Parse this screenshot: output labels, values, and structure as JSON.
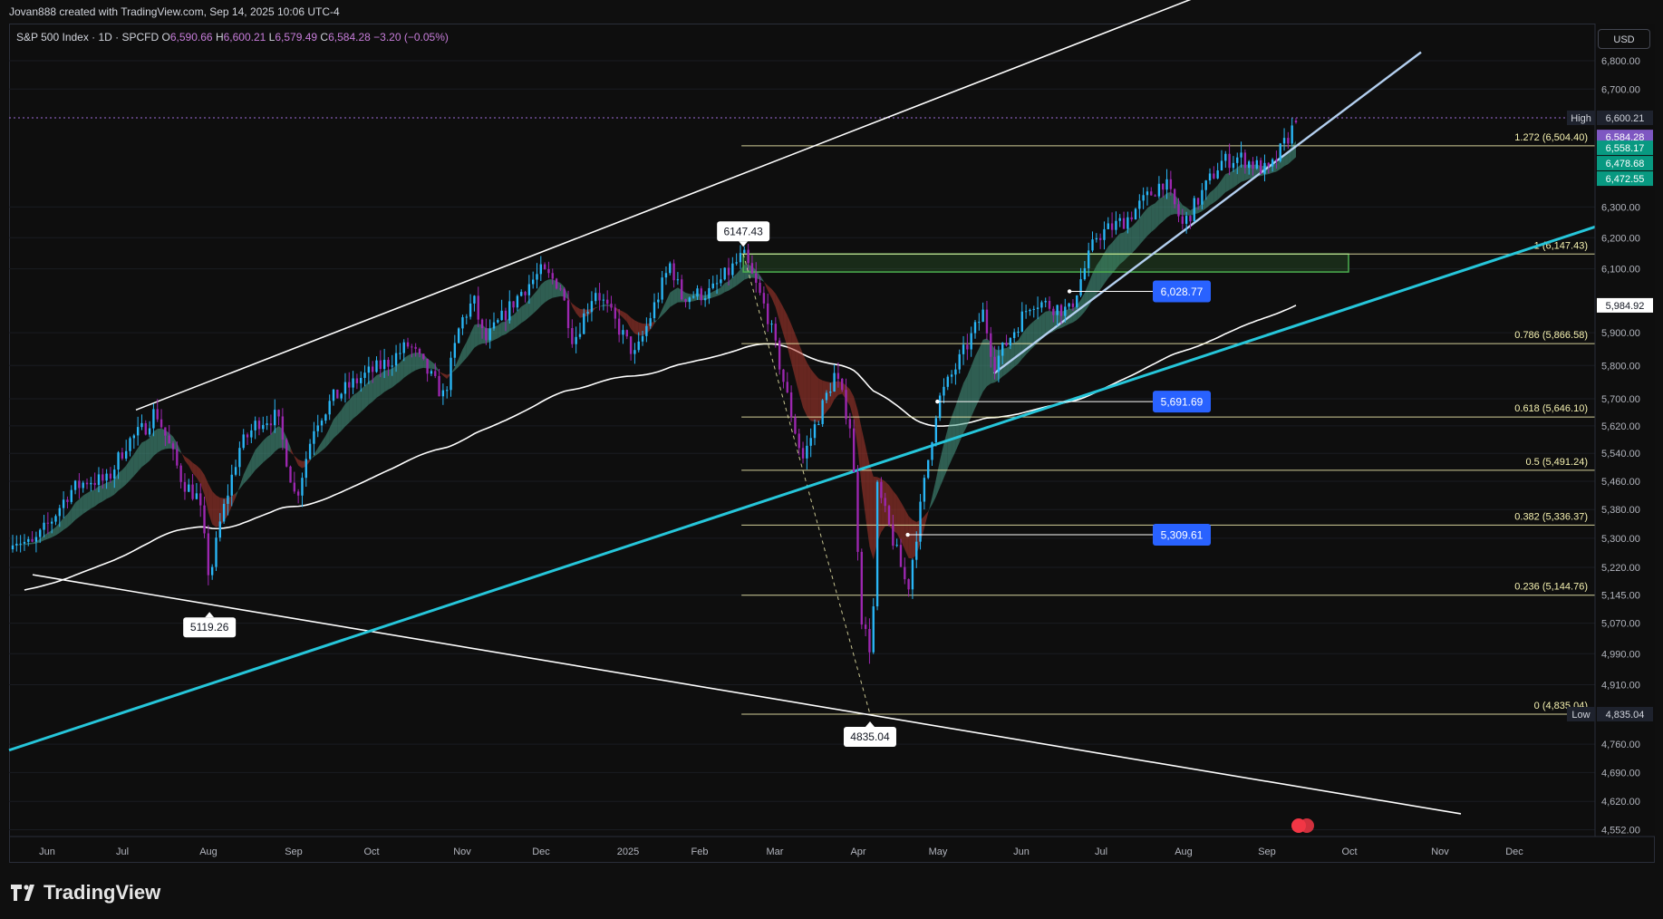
{
  "header": {
    "attribution": "Jovan888 created with TradingView.com, Sep 14, 2025 10:06 UTC-4"
  },
  "legend": {
    "symbol": "S&P 500 Index · 1D · SPCFD",
    "open_label": "O",
    "open": "6,590.66",
    "high_label": "H",
    "high": "6,600.21",
    "low_label": "L",
    "low": "6,579.49",
    "close_label": "C",
    "close": "6,584.28",
    "change": "−3.20 (−0.05%)"
  },
  "currency_button": "USD",
  "footer": {
    "brand": "TradingView"
  },
  "colors": {
    "background": "#0e0e0e",
    "up_candle": "#29b6f6",
    "down_candle": "#9c27b0",
    "ribbon_up": "#4aa08a",
    "ribbon_down": "#b03a30",
    "channel_line": "#ffffff",
    "cyan_trend": "#26c6da",
    "light_trend": "#b3cfef",
    "fib_line": "#f5f1b0",
    "zone": "#4caf50",
    "price_tag_blue": "#2962ff",
    "high_tag": "#7e57c2",
    "green_tag": "#089981"
  },
  "chart_data": {
    "type": "candlestick",
    "title": "S&P 500 Index · 1D · SPCFD",
    "x_ticks": [
      "Jun",
      "Jul",
      "Aug",
      "Sep",
      "Oct",
      "Nov",
      "Dec",
      "2025",
      "Feb",
      "Mar",
      "Apr",
      "May",
      "Jun",
      "Jul",
      "Aug",
      "Sep",
      "Oct",
      "Nov",
      "Dec"
    ],
    "y_ticks": [
      "6,800.00",
      "6,700.00",
      "6,300.00",
      "6,200.00",
      "6,100.00",
      "5,900.00",
      "5,800.00",
      "5,700.00",
      "5,620.00",
      "5,540.00",
      "5,460.00",
      "5,380.00",
      "5,300.00",
      "5,220.00",
      "5,145.00",
      "5,070.00",
      "4,990.00",
      "4,910.00",
      "4,760.00",
      "4,690.00",
      "4,620.00",
      "4,552.00"
    ],
    "y_range": [
      4552,
      6800
    ],
    "y_scale": "log",
    "price_anchors": [
      {
        "date": "2024-05-24",
        "close": 5304
      },
      {
        "date": "2024-05-31",
        "close": 5278
      },
      {
        "date": "2024-06-07",
        "close": 5346
      },
      {
        "date": "2024-06-14",
        "close": 5431
      },
      {
        "date": "2024-06-21",
        "close": 5464
      },
      {
        "date": "2024-06-28",
        "close": 5460
      },
      {
        "date": "2024-07-05",
        "close": 5567
      },
      {
        "date": "2024-07-12",
        "close": 5615
      },
      {
        "date": "2024-07-16",
        "close": 5667
      },
      {
        "date": "2024-07-26",
        "close": 5459
      },
      {
        "date": "2024-08-01",
        "close": 5410
      },
      {
        "date": "2024-08-05",
        "close": 5186
      },
      {
        "date": "2024-08-09",
        "close": 5344
      },
      {
        "date": "2024-08-16",
        "close": 5554
      },
      {
        "date": "2024-08-23",
        "close": 5634
      },
      {
        "date": "2024-08-30",
        "close": 5648
      },
      {
        "date": "2024-09-06",
        "close": 5408
      },
      {
        "date": "2024-09-13",
        "close": 5626
      },
      {
        "date": "2024-09-20",
        "close": 5702
      },
      {
        "date": "2024-09-30",
        "close": 5762
      },
      {
        "date": "2024-10-11",
        "close": 5815
      },
      {
        "date": "2024-10-18",
        "close": 5864
      },
      {
        "date": "2024-10-31",
        "close": 5705
      },
      {
        "date": "2024-11-06",
        "close": 5929
      },
      {
        "date": "2024-11-11",
        "close": 6001
      },
      {
        "date": "2024-11-15",
        "close": 5870
      },
      {
        "date": "2024-11-29",
        "close": 6032
      },
      {
        "date": "2024-12-06",
        "close": 6090
      },
      {
        "date": "2024-12-13",
        "close": 6051
      },
      {
        "date": "2024-12-18",
        "close": 5872
      },
      {
        "date": "2024-12-26",
        "close": 6037
      },
      {
        "date": "2025-01-10",
        "close": 5827
      },
      {
        "date": "2025-01-23",
        "close": 6118
      },
      {
        "date": "2025-01-27",
        "close": 6012
      },
      {
        "date": "2025-02-07",
        "close": 6026
      },
      {
        "date": "2025-02-19",
        "close": 6144
      },
      {
        "date": "2025-02-28",
        "close": 5955
      },
      {
        "date": "2025-03-10",
        "close": 5614
      },
      {
        "date": "2025-03-13",
        "close": 5522
      },
      {
        "date": "2025-03-25",
        "close": 5776
      },
      {
        "date": "2025-03-31",
        "close": 5612
      },
      {
        "date": "2025-04-04",
        "close": 5074
      },
      {
        "date": "2025-04-08",
        "close": 4982
      },
      {
        "date": "2025-04-09",
        "close": 5457
      },
      {
        "date": "2025-04-21",
        "close": 5158
      },
      {
        "date": "2025-05-02",
        "close": 5687
      },
      {
        "date": "2025-05-12",
        "close": 5844
      },
      {
        "date": "2025-05-19",
        "close": 5963
      },
      {
        "date": "2025-05-23",
        "close": 5803
      },
      {
        "date": "2025-06-06",
        "close": 6000
      },
      {
        "date": "2025-06-20",
        "close": 5967
      },
      {
        "date": "2025-06-30",
        "close": 6205
      },
      {
        "date": "2025-07-11",
        "close": 6260
      },
      {
        "date": "2025-07-25",
        "close": 6389
      },
      {
        "date": "2025-08-01",
        "close": 6238
      },
      {
        "date": "2025-08-15",
        "close": 6449
      },
      {
        "date": "2025-08-22",
        "close": 6466
      },
      {
        "date": "2025-09-02",
        "close": 6415
      },
      {
        "date": "2025-09-12",
        "close": 6584
      }
    ],
    "fibonacci": [
      {
        "label": "1.272 (6,504.40)",
        "value": 6504.4
      },
      {
        "label": "1 (6,147.43)",
        "value": 6147.43
      },
      {
        "label": "0.786 (5,866.58)",
        "value": 5866.58
      },
      {
        "label": "0.618 (5,646.10)",
        "value": 5646.1
      },
      {
        "label": "0.5 (5,491.24)",
        "value": 5491.24
      },
      {
        "label": "0.382 (5,336.37)",
        "value": 5336.37
      },
      {
        "label": "0.236 (5,144.76)",
        "value": 5144.76
      },
      {
        "label": "0 (4,835.04)",
        "value": 4835.04
      }
    ],
    "annotations": [
      {
        "text": "6147.43",
        "value": 6147.43,
        "date": "2025-02-19"
      },
      {
        "text": "5119.26",
        "value": 5119.26,
        "date": "2024-08-05"
      },
      {
        "text": "4835.04",
        "value": 4835.04,
        "date": "2025-04-07"
      }
    ],
    "level_tags": [
      {
        "text": "6,028.77",
        "value": 6028.77
      },
      {
        "text": "5,691.69",
        "value": 5691.69
      },
      {
        "text": "5,309.61",
        "value": 5309.61
      }
    ],
    "axis_tags": [
      {
        "text": "High",
        "value": 6600.21
      },
      {
        "text": "6,600.21",
        "value": 6600.21
      },
      {
        "text": "6,584.28",
        "value": 6584.28
      },
      {
        "text": "6,558.17",
        "value": 6558.17
      },
      {
        "text": "6,478.68",
        "value": 6478.68
      },
      {
        "text": "6,472.55",
        "value": 6472.55
      },
      {
        "text": "5,984.92",
        "value": 5984.92
      },
      {
        "text": "Low",
        "value": 4835.04
      },
      {
        "text": "4,835.04",
        "value": 4835.04
      }
    ],
    "zone": {
      "from": 6090,
      "to": 6147.43
    },
    "moving_average_200_end": 5984.92
  }
}
